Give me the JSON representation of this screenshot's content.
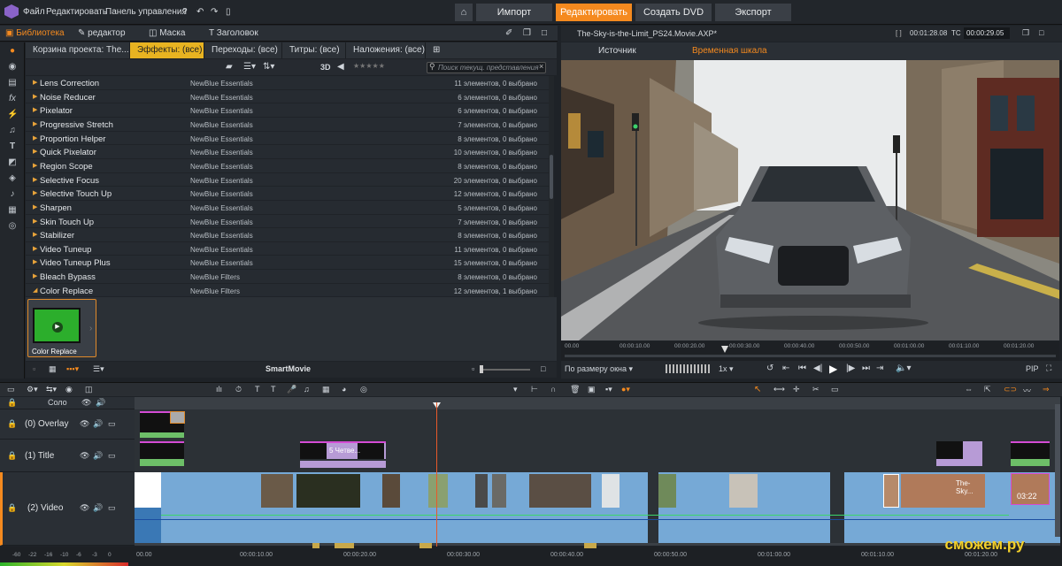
{
  "menu": {
    "file": "Файл",
    "edit": "Редактировать",
    "control_panel": "Панель управления"
  },
  "nav": {
    "import": "Импорт",
    "edit": "Редактировать",
    "create_dvd": "Создать DVD",
    "export": "Экспорт"
  },
  "lib_tabs": {
    "library": "Библиотека",
    "editor": "редактор",
    "mask": "Маска",
    "title": "Заголовок"
  },
  "effect_tabs": {
    "bin": "Корзина проекта: The...",
    "effects": "Эффекты: (все)",
    "transitions": "Переходы: (все)",
    "titles": "Титры: (все)",
    "overlays": "Наложения: (все)"
  },
  "toolbar": {
    "three_d": "3D",
    "search_placeholder": "Поиск текущ. представления"
  },
  "effects": [
    {
      "name": "Lens Correction",
      "vendor": "NewBlue Essentials",
      "count": "11 элементов, 0 выбрано"
    },
    {
      "name": "Noise Reducer",
      "vendor": "NewBlue Essentials",
      "count": "6 элементов, 0 выбрано"
    },
    {
      "name": "Pixelator",
      "vendor": "NewBlue Essentials",
      "count": "6 элементов, 0 выбрано"
    },
    {
      "name": "Progressive Stretch",
      "vendor": "NewBlue Essentials",
      "count": "7 элементов, 0 выбрано"
    },
    {
      "name": "Proportion Helper",
      "vendor": "NewBlue Essentials",
      "count": "8 элементов, 0 выбрано"
    },
    {
      "name": "Quick Pixelator",
      "vendor": "NewBlue Essentials",
      "count": "10 элементов, 0 выбрано"
    },
    {
      "name": "Region Scope",
      "vendor": "NewBlue Essentials",
      "count": "8 элементов, 0 выбрано"
    },
    {
      "name": "Selective Focus",
      "vendor": "NewBlue Essentials",
      "count": "20 элементов, 0 выбрано"
    },
    {
      "name": "Selective Touch Up",
      "vendor": "NewBlue Essentials",
      "count": "12 элементов, 0 выбрано"
    },
    {
      "name": "Sharpen",
      "vendor": "NewBlue Essentials",
      "count": "5 элементов, 0 выбрано"
    },
    {
      "name": "Skin Touch Up",
      "vendor": "NewBlue Essentials",
      "count": "7 элементов, 0 выбрано"
    },
    {
      "name": "Stabilizer",
      "vendor": "NewBlue Essentials",
      "count": "8 элементов, 0 выбрано"
    },
    {
      "name": "Video Tuneup",
      "vendor": "NewBlue Essentials",
      "count": "11 элементов, 0 выбрано"
    },
    {
      "name": "Video Tuneup Plus",
      "vendor": "NewBlue Essentials",
      "count": "15 элементов, 0 выбрано"
    },
    {
      "name": "Bleach Bypass",
      "vendor": "NewBlue Filters",
      "count": "8 элементов, 0 выбрано"
    },
    {
      "name": "Color Replace",
      "vendor": "NewBlue Filters",
      "count": "12 элементов, 1 выбрано"
    }
  ],
  "bin_item": {
    "label": "Color Replace"
  },
  "smartmovie": "SmartMovie",
  "preview": {
    "filename": "The-Sky-is-the-Limit_PS24.Movie.AXP*",
    "duration": "00:01:28.08",
    "tc_label": "TC",
    "timecode": "00:00:29.05",
    "source_tab": "Источник",
    "timeline_tab": "Временная шкала",
    "fit": "По размеру окна",
    "speed": "1x",
    "pip": "PIP"
  },
  "ruler_ticks": [
    "00.00",
    "00:00:10.00",
    "00:00:20.00",
    "00:00:30.00",
    "00:00:40.00",
    "00:00:50.00",
    "00:01:00.00",
    "00:01:10.00",
    "00:01:20.00"
  ],
  "tracks": {
    "solo": "Соло",
    "overlay": "(0) Overlay",
    "title": "(1) Title",
    "video": "(2) Video"
  },
  "clips": {
    "title_text": "5 Четве...",
    "sky_text": "The-Sky...",
    "clip_time": "03:22"
  },
  "bottom_ruler": [
    "00.00",
    "00:00:10.00",
    "00:00:20.00",
    "00:00:30.00",
    "00:00:40.00",
    "00:00:50.00",
    "00:01:00.00",
    "00:01:10.00",
    "00:01:20.00"
  ],
  "meter_ticks": [
    "-60",
    "-22",
    "-16",
    "-10",
    "-6",
    "-3",
    "0"
  ],
  "watermark": "сможем.ру",
  "colors": {
    "accent": "#f58a1f",
    "effects_tab": "#e8b321",
    "clip_blue": "#76a9d6",
    "clip_purple": "#b79bd6",
    "clip_green": "#6dbf68"
  }
}
